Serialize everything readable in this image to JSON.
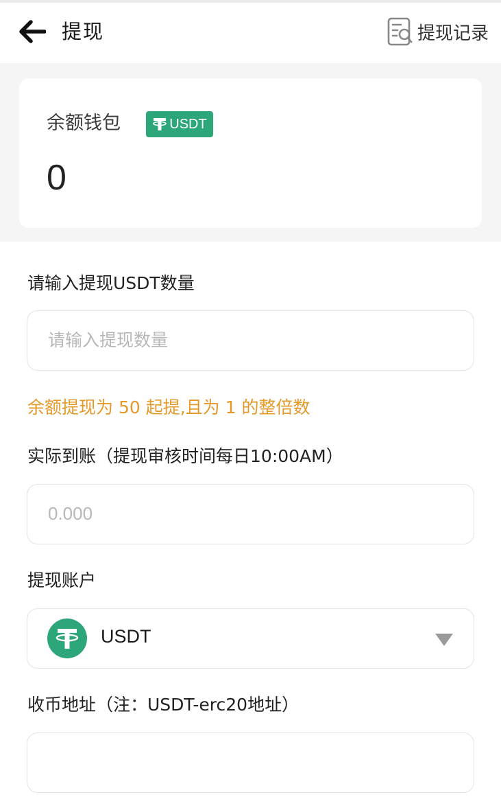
{
  "header": {
    "title": "提现",
    "records_label": "提现记录",
    "back_icon": "arrow-left-icon",
    "records_icon": "document-search-icon"
  },
  "wallet": {
    "title": "余额钱包",
    "badge_label": "USDT",
    "balance": "0",
    "badge_color": "#2da77a"
  },
  "form": {
    "amount_label": "请输入提现USDT数量",
    "amount_placeholder": "请输入提现数量",
    "hint": "余额提现为 50 起提,且为 1 的整倍数",
    "hint_color": "#e49a2a",
    "actual_label": "实际到账（提现审核时间每日10:00AM）",
    "actual_placeholder": "0.000",
    "account_label": "提现账户",
    "account_selected": "USDT",
    "address_label": "收币地址（注：USDT-erc20地址）",
    "address_value": ""
  }
}
